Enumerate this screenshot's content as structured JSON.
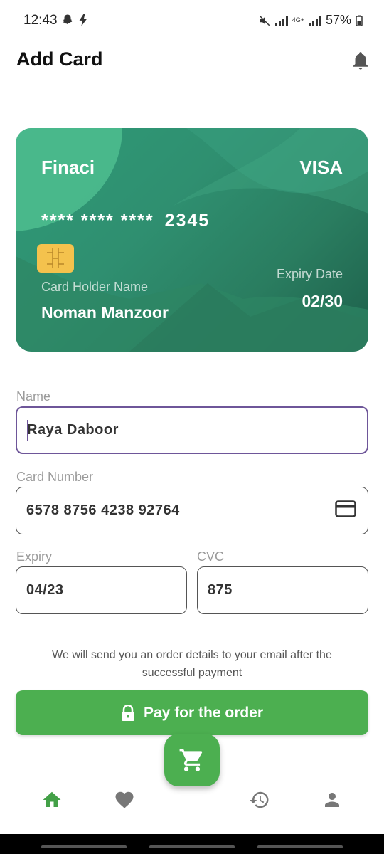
{
  "status_bar": {
    "time": "12:43",
    "battery": "57%",
    "network": "4G+"
  },
  "header": {
    "title": "Add Card",
    "icon": "bell-icon"
  },
  "card": {
    "brand": "Finaci",
    "network": "VISA",
    "number_masked": "**** **** ****",
    "number_last4": "2345",
    "holder_label": "Card Holder Name",
    "holder_name": "Noman Manzoor",
    "expiry_label": "Expiry Date",
    "expiry": "02/30",
    "gradient_colors": [
      "#2f9a77",
      "#2a7d60",
      "#1d5f4a"
    ],
    "chip_color": "#f4c24d"
  },
  "form": {
    "name": {
      "label": "Name",
      "value": "Raya Daboor"
    },
    "card_number": {
      "label": "Card Number",
      "value": "6578 8756 4238 92764",
      "icon": "credit-card-icon"
    },
    "expiry": {
      "label": "Expiry",
      "value": "04/23"
    },
    "cvc": {
      "label": "CVC",
      "value": "875"
    }
  },
  "note": "We will send you an order details to your email after the successful payment",
  "pay_button": {
    "label": "Pay for the order",
    "icon": "lock-icon",
    "color": "#4caf50"
  },
  "bottom_nav": {
    "items": [
      {
        "icon": "home-icon",
        "active": true
      },
      {
        "icon": "heart-icon",
        "active": false
      },
      {
        "icon": "history-icon",
        "active": false
      },
      {
        "icon": "person-icon",
        "active": false
      }
    ],
    "fab_icon": "cart-icon",
    "active_color": "#43a047"
  }
}
